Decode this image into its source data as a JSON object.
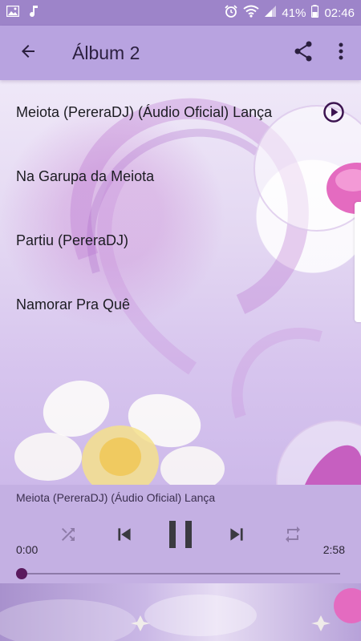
{
  "status_bar": {
    "battery": "41%",
    "time": "02:46",
    "icons": [
      "image-icon",
      "music-note-icon",
      "alarm-icon",
      "wifi-icon",
      "signal-icon",
      "battery-icon"
    ]
  },
  "app_bar": {
    "title": "Álbum 2",
    "icons": [
      "back-arrow-icon",
      "share-icon",
      "more-vert-icon"
    ]
  },
  "tracks": [
    {
      "title": "Meiota (PereraDJ) (Áudio Oficial) Lança",
      "playing": true
    },
    {
      "title": "Na Garupa da Meiota",
      "playing": false
    },
    {
      "title": "Partiu (PereraDJ)",
      "playing": false
    },
    {
      "title": "Namorar Pra Quê",
      "playing": false
    }
  ],
  "player": {
    "now_playing": "Meiota (PereraDJ) (Áudio Oficial) Lança",
    "elapsed": "0:00",
    "duration": "2:58",
    "progress": 0.0,
    "controls": [
      "shuffle-icon",
      "skip-previous-icon",
      "pause-icon",
      "skip-next-icon",
      "repeat-icon"
    ]
  },
  "colors": {
    "status_bar": "#9d84c9",
    "app_bar": "#b8a3e0",
    "player": "#c4b0e3",
    "accent": "#5a1a5e"
  }
}
